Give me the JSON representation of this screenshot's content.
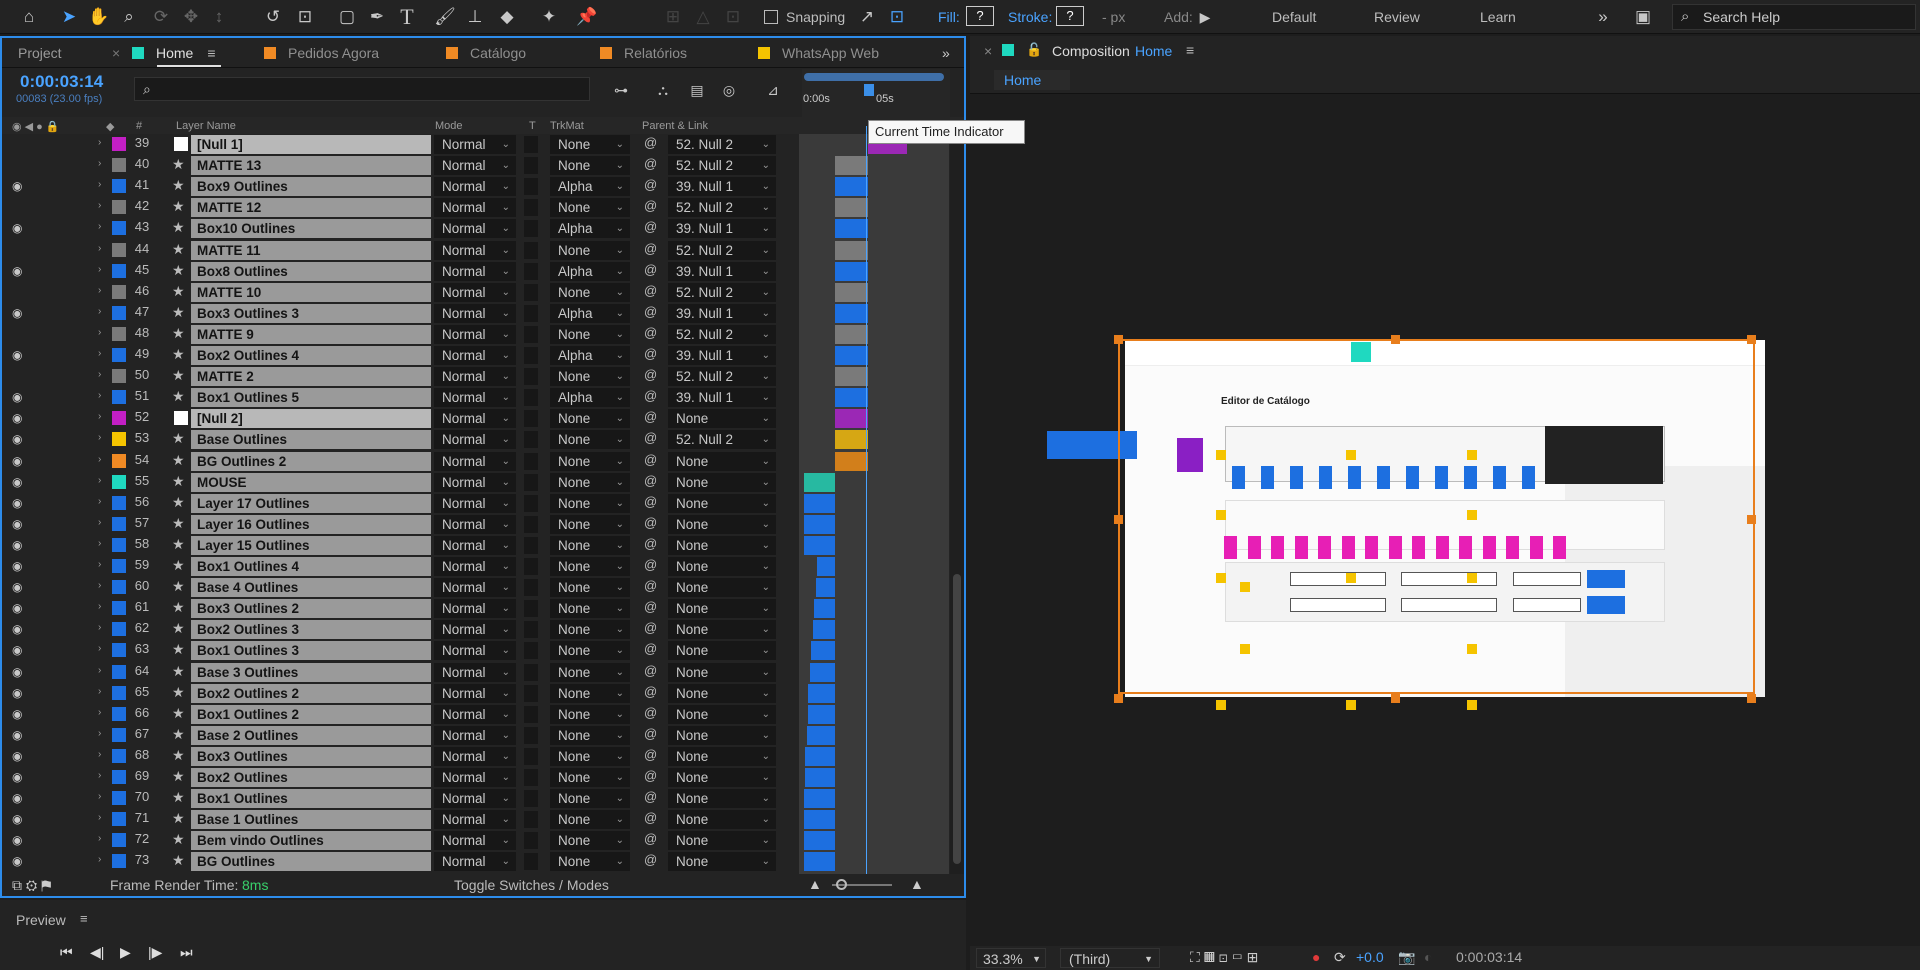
{
  "toolbar": {
    "snapping_label": "Snapping",
    "fill_label": "Fill:",
    "fill_value": "?",
    "stroke_label": "Stroke:",
    "stroke_value": "?",
    "stroke_unit": "- px",
    "add_label": "Add:",
    "workspaces": [
      "Default",
      "Review",
      "Learn"
    ],
    "search_placeholder": "Search Help"
  },
  "left_tabs": [
    {
      "label": "Project",
      "color": ""
    },
    {
      "label": "Home",
      "color": "#1fd9c0"
    },
    {
      "label": "Pedidos Agora",
      "color": "#f08a24"
    },
    {
      "label": "Catálogo",
      "color": "#f08a24"
    },
    {
      "label": "Relatórios",
      "color": "#f08a24"
    },
    {
      "label": "WhatsApp Web",
      "color": "#f5c400"
    }
  ],
  "timeline": {
    "current_time": "0:00:03:14",
    "frame_info": "00083 (23.00 fps)",
    "ruler_start": "0:00s",
    "ruler_mark": "05s",
    "tooltip": "Current Time Indicator",
    "columns": {
      "hash": "#",
      "layer_name": "Layer Name",
      "mode": "Mode",
      "t": "T",
      "trkmat": "TrkMat",
      "parent": "Parent & Link"
    },
    "layers": [
      {
        "num": "39",
        "name": "[Null 1]",
        "mode": "Normal",
        "trk": "None",
        "parent": "52. Null 2",
        "color": "#c31fc4",
        "eye": false,
        "type": "null",
        "bar": "#9b28b5",
        "bs": 0.46,
        "be": 0.72
      },
      {
        "num": "40",
        "name": "MATTE 13",
        "mode": "Normal",
        "trk": "None",
        "parent": "52. Null 2",
        "color": "#7a7a7a",
        "eye": false,
        "type": "shape",
        "bar": "#7a7a7a",
        "bs": 0.24,
        "be": 0.46
      },
      {
        "num": "41",
        "name": "Box9 Outlines",
        "mode": "Normal",
        "trk": "Alpha",
        "parent": "39. Null 1",
        "color": "#1d6fe0",
        "eye": true,
        "type": "shape",
        "bar": "#1d6fe0",
        "bs": 0.24,
        "be": 0.46
      },
      {
        "num": "42",
        "name": "MATTE 12",
        "mode": "Normal",
        "trk": "None",
        "parent": "52. Null 2",
        "color": "#7a7a7a",
        "eye": false,
        "type": "shape",
        "bar": "#7a7a7a",
        "bs": 0.24,
        "be": 0.46
      },
      {
        "num": "43",
        "name": "Box10 Outlines",
        "mode": "Normal",
        "trk": "Alpha",
        "parent": "39. Null 1",
        "color": "#1d6fe0",
        "eye": true,
        "type": "shape",
        "bar": "#1d6fe0",
        "bs": 0.24,
        "be": 0.46
      },
      {
        "num": "44",
        "name": "MATTE 11",
        "mode": "Normal",
        "trk": "None",
        "parent": "52. Null 2",
        "color": "#7a7a7a",
        "eye": false,
        "type": "shape",
        "bar": "#7a7a7a",
        "bs": 0.24,
        "be": 0.46
      },
      {
        "num": "45",
        "name": "Box8 Outlines",
        "mode": "Normal",
        "trk": "Alpha",
        "parent": "39. Null 1",
        "color": "#1d6fe0",
        "eye": true,
        "type": "shape",
        "bar": "#1d6fe0",
        "bs": 0.24,
        "be": 0.46
      },
      {
        "num": "46",
        "name": "MATTE 10",
        "mode": "Normal",
        "trk": "None",
        "parent": "52. Null 2",
        "color": "#7a7a7a",
        "eye": false,
        "type": "shape",
        "bar": "#7a7a7a",
        "bs": 0.24,
        "be": 0.46
      },
      {
        "num": "47",
        "name": "Box3 Outlines 3",
        "mode": "Normal",
        "trk": "Alpha",
        "parent": "39. Null 1",
        "color": "#1d6fe0",
        "eye": true,
        "type": "shape",
        "bar": "#1d6fe0",
        "bs": 0.24,
        "be": 0.46
      },
      {
        "num": "48",
        "name": "MATTE 9",
        "mode": "Normal",
        "trk": "None",
        "parent": "52. Null 2",
        "color": "#7a7a7a",
        "eye": false,
        "type": "shape",
        "bar": "#7a7a7a",
        "bs": 0.24,
        "be": 0.46
      },
      {
        "num": "49",
        "name": "Box2 Outlines 4",
        "mode": "Normal",
        "trk": "Alpha",
        "parent": "39. Null 1",
        "color": "#1d6fe0",
        "eye": true,
        "type": "shape",
        "bar": "#1d6fe0",
        "bs": 0.24,
        "be": 0.46
      },
      {
        "num": "50",
        "name": "MATTE 2",
        "mode": "Normal",
        "trk": "None",
        "parent": "52. Null 2",
        "color": "#7a7a7a",
        "eye": false,
        "type": "shape",
        "bar": "#7a7a7a",
        "bs": 0.24,
        "be": 0.46
      },
      {
        "num": "51",
        "name": "Box1 Outlines 5",
        "mode": "Normal",
        "trk": "Alpha",
        "parent": "39. Null 1",
        "color": "#1d6fe0",
        "eye": true,
        "type": "shape",
        "bar": "#1d6fe0",
        "bs": 0.24,
        "be": 0.46
      },
      {
        "num": "52",
        "name": "[Null 2]",
        "mode": "Normal",
        "trk": "None",
        "parent": "None",
        "color": "#c31fc4",
        "eye": true,
        "type": "null",
        "bar": "#9b28b5",
        "bs": 0.24,
        "be": 0.46
      },
      {
        "num": "53",
        "name": "Base Outlines",
        "mode": "Normal",
        "trk": "None",
        "parent": "52. Null 2",
        "color": "#f5c400",
        "eye": true,
        "type": "shape",
        "bar": "#d6a714",
        "bs": 0.24,
        "be": 0.46
      },
      {
        "num": "54",
        "name": "BG Outlines 2",
        "mode": "Normal",
        "trk": "None",
        "parent": "None",
        "color": "#f08a24",
        "eye": true,
        "type": "shape",
        "bar": "#d27f1b",
        "bs": 0.24,
        "be": 0.46
      },
      {
        "num": "55",
        "name": "MOUSE",
        "mode": "Normal",
        "trk": "None",
        "parent": "None",
        "color": "#1fd9c0",
        "eye": true,
        "type": "shape",
        "bar": "#27b9a1",
        "bs": 0.03,
        "be": 0.24
      },
      {
        "num": "56",
        "name": "Layer 17 Outlines",
        "mode": "Normal",
        "trk": "None",
        "parent": "None",
        "color": "#1d6fe0",
        "eye": true,
        "type": "shape",
        "bar": "#1d6fe0",
        "bs": 0.03,
        "be": 0.24
      },
      {
        "num": "57",
        "name": "Layer 16 Outlines",
        "mode": "Normal",
        "trk": "None",
        "parent": "None",
        "color": "#1d6fe0",
        "eye": true,
        "type": "shape",
        "bar": "#1d6fe0",
        "bs": 0.03,
        "be": 0.24
      },
      {
        "num": "58",
        "name": "Layer 15 Outlines",
        "mode": "Normal",
        "trk": "None",
        "parent": "None",
        "color": "#1d6fe0",
        "eye": true,
        "type": "shape",
        "bar": "#1d6fe0",
        "bs": 0.03,
        "be": 0.24
      },
      {
        "num": "59",
        "name": "Box1 Outlines 4",
        "mode": "Normal",
        "trk": "None",
        "parent": "None",
        "color": "#1d6fe0",
        "eye": true,
        "type": "shape",
        "bar": "#1d6fe0",
        "bs": 0.12,
        "be": 0.24
      },
      {
        "num": "60",
        "name": "Base 4 Outlines",
        "mode": "Normal",
        "trk": "None",
        "parent": "None",
        "color": "#1d6fe0",
        "eye": true,
        "type": "shape",
        "bar": "#1d6fe0",
        "bs": 0.11,
        "be": 0.24
      },
      {
        "num": "61",
        "name": "Box3 Outlines 2",
        "mode": "Normal",
        "trk": "None",
        "parent": "None",
        "color": "#1d6fe0",
        "eye": true,
        "type": "shape",
        "bar": "#1d6fe0",
        "bs": 0.1,
        "be": 0.24
      },
      {
        "num": "62",
        "name": "Box2 Outlines 3",
        "mode": "Normal",
        "trk": "None",
        "parent": "None",
        "color": "#1d6fe0",
        "eye": true,
        "type": "shape",
        "bar": "#1d6fe0",
        "bs": 0.09,
        "be": 0.24
      },
      {
        "num": "63",
        "name": "Box1 Outlines 3",
        "mode": "Normal",
        "trk": "None",
        "parent": "None",
        "color": "#1d6fe0",
        "eye": true,
        "type": "shape",
        "bar": "#1d6fe0",
        "bs": 0.08,
        "be": 0.24
      },
      {
        "num": "64",
        "name": "Base 3 Outlines",
        "mode": "Normal",
        "trk": "None",
        "parent": "None",
        "color": "#1d6fe0",
        "eye": true,
        "type": "shape",
        "bar": "#1d6fe0",
        "bs": 0.07,
        "be": 0.24
      },
      {
        "num": "65",
        "name": "Box2 Outlines 2",
        "mode": "Normal",
        "trk": "None",
        "parent": "None",
        "color": "#1d6fe0",
        "eye": true,
        "type": "shape",
        "bar": "#1d6fe0",
        "bs": 0.06,
        "be": 0.24
      },
      {
        "num": "66",
        "name": "Box1 Outlines 2",
        "mode": "Normal",
        "trk": "None",
        "parent": "None",
        "color": "#1d6fe0",
        "eye": true,
        "type": "shape",
        "bar": "#1d6fe0",
        "bs": 0.06,
        "be": 0.24
      },
      {
        "num": "67",
        "name": "Base 2 Outlines",
        "mode": "Normal",
        "trk": "None",
        "parent": "None",
        "color": "#1d6fe0",
        "eye": true,
        "type": "shape",
        "bar": "#1d6fe0",
        "bs": 0.05,
        "be": 0.24
      },
      {
        "num": "68",
        "name": "Box3 Outlines",
        "mode": "Normal",
        "trk": "None",
        "parent": "None",
        "color": "#1d6fe0",
        "eye": true,
        "type": "shape",
        "bar": "#1d6fe0",
        "bs": 0.04,
        "be": 0.24
      },
      {
        "num": "69",
        "name": "Box2 Outlines",
        "mode": "Normal",
        "trk": "None",
        "parent": "None",
        "color": "#1d6fe0",
        "eye": true,
        "type": "shape",
        "bar": "#1d6fe0",
        "bs": 0.04,
        "be": 0.24
      },
      {
        "num": "70",
        "name": "Box1 Outlines",
        "mode": "Normal",
        "trk": "None",
        "parent": "None",
        "color": "#1d6fe0",
        "eye": true,
        "type": "shape",
        "bar": "#1d6fe0",
        "bs": 0.03,
        "be": 0.24
      },
      {
        "num": "71",
        "name": "Base 1 Outlines",
        "mode": "Normal",
        "trk": "None",
        "parent": "None",
        "color": "#1d6fe0",
        "eye": true,
        "type": "shape",
        "bar": "#1d6fe0",
        "bs": 0.03,
        "be": 0.24
      },
      {
        "num": "72",
        "name": "Bem vindo Outlines",
        "mode": "Normal",
        "trk": "None",
        "parent": "None",
        "color": "#1d6fe0",
        "eye": true,
        "type": "shape",
        "bar": "#1d6fe0",
        "bs": 0.03,
        "be": 0.24
      },
      {
        "num": "73",
        "name": "BG Outlines",
        "mode": "Normal",
        "trk": "None",
        "parent": "None",
        "color": "#1d6fe0",
        "eye": true,
        "type": "shape",
        "bar": "#1d6fe0",
        "bs": 0.03,
        "be": 0.24
      }
    ],
    "frame_render_label": "Frame Render Time:",
    "frame_render_value": "8ms",
    "toggle_label": "Toggle Switches / Modes"
  },
  "preview": {
    "title": "Preview"
  },
  "composition": {
    "panel_title": "Composition",
    "comp_name": "Home",
    "breadcrumb": "Home",
    "canvas_title": "Editor de Catálogo",
    "zoom": "33.3%",
    "resolution": "(Third)",
    "exposure": "+0.0",
    "timecode": "0:00:03:14"
  },
  "colors": {
    "accent_blue": "#2d8ceb",
    "label_blue": "#1d6fe0",
    "label_magenta": "#e71fb5",
    "label_yellow": "#f5c400",
    "label_orange": "#f08a24",
    "label_teal": "#1fd9c0"
  }
}
